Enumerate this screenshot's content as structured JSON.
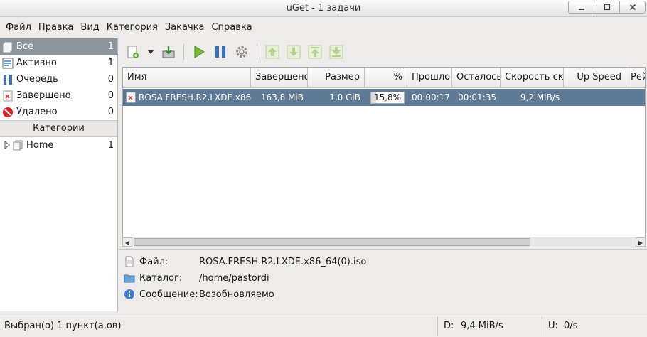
{
  "window": {
    "title": "uGet - 1 задачи"
  },
  "menu": [
    "Файл",
    "Правка",
    "Вид",
    "Категория",
    "Закачка",
    "Справка"
  ],
  "states": [
    {
      "label": "Все",
      "count": "1",
      "icon": "all-icon"
    },
    {
      "label": "Активно",
      "count": "1",
      "icon": "active-icon"
    },
    {
      "label": "Очередь",
      "count": "0",
      "icon": "queue-icon"
    },
    {
      "label": "Завершено",
      "count": "0",
      "icon": "finished-icon"
    },
    {
      "label": "Удалено",
      "count": "0",
      "icon": "deleted-icon"
    }
  ],
  "categories_header": "Категории",
  "categories": [
    {
      "label": "Home",
      "count": "1"
    }
  ],
  "columns": [
    "Имя",
    "Завершено",
    "Размер",
    "%",
    "Прошло",
    "Осталось",
    "Скорость скачивания",
    "Up Speed",
    "Рейтинг"
  ],
  "download": {
    "name": "ROSA.FRESH.R2.LXDE.x86_64(0).iso",
    "completed": "163,8 MiB",
    "size": "1,0 GiB",
    "percent_text": "15,8%",
    "percent": 15.8,
    "elapsed": "00:00:17",
    "remaining": "00:01:35",
    "speed": "9,2 MiB/s",
    "up_speed": ""
  },
  "details": {
    "file_label": "Файл:",
    "file_value": "ROSA.FRESH.R2.LXDE.x86_64(0).iso",
    "folder_label": "Каталог:",
    "folder_value": "/home/pastordi",
    "message_label": "Сообщение:",
    "message_value": "Возобновляемо"
  },
  "status": {
    "selection": "Выбран(о) 1 пункт(а,ов)",
    "down_label": "D:",
    "down_value": "9,4 MiB/s",
    "up_label": "U:",
    "up_value": "0/s"
  },
  "colors": {
    "selected_row": "#5e7a96",
    "selected_state": "#8c949e",
    "accent_green": "#7ab837",
    "accent_blue": "#3b7bd4"
  }
}
